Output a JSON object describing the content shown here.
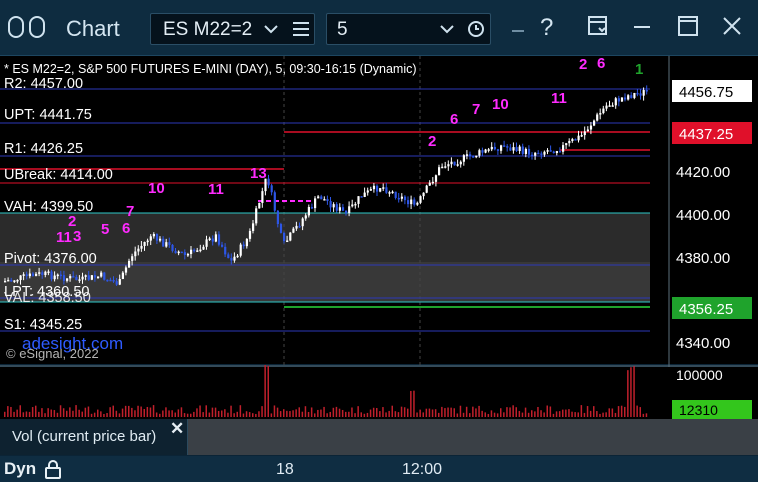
{
  "window": {
    "title": "Chart",
    "symbol": "ES M22=2",
    "interval": "5"
  },
  "chart": {
    "description": "* ES M22=2, S&P 500 FUTURES E-MINI (DAY), 5, 09:30-16:15 (Dynamic)",
    "copyright": "© eSignal, 2022",
    "watermark": "adesight.com",
    "price_axis": [
      "4420.00",
      "4400.00",
      "4380.00",
      "4340.00"
    ],
    "price_tags": {
      "last": "4456.75",
      "red": "4437.25",
      "green": "4356.25"
    },
    "levels": [
      {
        "label": "R2: 4457.00"
      },
      {
        "label": "UPT: 4441.75"
      },
      {
        "label": "R1: 4426.25"
      },
      {
        "label": "UBreak: 4414.00"
      },
      {
        "label": "VAH: 4399.50"
      },
      {
        "label": "Pivot: 4376.00"
      },
      {
        "label": "LPT: 4360.50"
      },
      {
        "label": "VAL: 4358.50"
      },
      {
        "label": "S1: 4345.25"
      }
    ],
    "annotations": [
      "2",
      "6",
      "1",
      "7",
      "10",
      "11",
      "6",
      "2",
      "13",
      "10",
      "11",
      "7",
      "6",
      "5",
      "11",
      "2",
      "3"
    ],
    "volume_axis": {
      "top": "100000",
      "last_tag": "12310"
    }
  },
  "vol_panel": {
    "label": "Vol (current price bar)"
  },
  "timebar": {
    "mode": "Dyn",
    "labels": [
      "18",
      "12:00"
    ]
  },
  "colors": {
    "up": "#ffffff",
    "down": "#2d56e6",
    "red_line": "#e0102a",
    "green_tag": "#1fa32c",
    "magenta": "#ff2bff"
  }
}
